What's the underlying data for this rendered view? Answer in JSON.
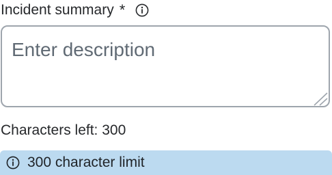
{
  "field": {
    "label": "Incident summary",
    "required_marker": "*",
    "placeholder": "Enter description",
    "value": ""
  },
  "counter": {
    "text": "Characters left: 300"
  },
  "notice": {
    "text": "300 character limit"
  },
  "icons": {
    "label_info": "info-circle-icon",
    "notice_info": "info-circle-icon",
    "resize": "resize-grip-icon"
  },
  "colors": {
    "text": "#26282b",
    "placeholder": "#606a74",
    "border": "#9ea5ad",
    "notice_bg": "#bcdaf0"
  }
}
